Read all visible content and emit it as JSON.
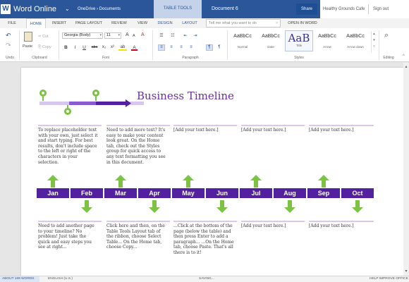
{
  "titlebar": {
    "logo_letter": "W",
    "app_name": "Word Online",
    "caret": "⌄",
    "breadcrumb": "OneDrive › Documents",
    "tool_band": "TABLE TOOLS",
    "document_name": "Document 6",
    "share": "Share",
    "user": "Healthy Grounds Cafe",
    "signout": "Sign out"
  },
  "tabs": [
    {
      "label": "FILE"
    },
    {
      "label": "HOME"
    },
    {
      "label": "INSERT"
    },
    {
      "label": "PAGE LAYOUT"
    },
    {
      "label": "REVIEW"
    },
    {
      "label": "VIEW"
    },
    {
      "label": "DESIGN"
    },
    {
      "label": "LAYOUT"
    },
    {
      "label": "OPEN IN WORD"
    }
  ],
  "tellme_placeholder": "Tell me what you want to do",
  "ribbon": {
    "undo_icon": "↶",
    "redo_icon": "↷",
    "paste_label": "Paste",
    "cut_label": "Cut",
    "copy_label": "Copy",
    "font_name": "Georgia (Body)",
    "font_size": "11",
    "grow_font": "A",
    "shrink_font": "A",
    "clear_format": "A",
    "bold": "B",
    "italic": "I",
    "underline": "U",
    "strike": "abc",
    "subscript": "x₂",
    "superscript": "x²",
    "highlight": "ab",
    "font_color": "A",
    "bullets_icon": "☰",
    "numbering_icon": "☷",
    "decrease_indent": "⇤",
    "increase_indent": "⇥",
    "align_left": "≡",
    "align_center": "≡",
    "align_right": "≡",
    "justify": "≡",
    "ltr": "¶",
    "rtl": "¶",
    "groups": {
      "undo": "Undo",
      "clipboard": "Clipboard",
      "font": "Font",
      "paragraph": "Paragraph",
      "styles": "Styles",
      "editing": "Editing"
    },
    "styles": [
      {
        "sample": "AaBbCc",
        "name": "Normal"
      },
      {
        "sample": "AaBbCc",
        "name": "Date"
      },
      {
        "sample": "AaB",
        "name": "Title"
      },
      {
        "sample": "AaBbCc",
        "name": "Arrow"
      },
      {
        "sample": "AaBbCc",
        "name": "Arrow down"
      }
    ],
    "find_icon": "⌕"
  },
  "document": {
    "heading": "Business Timeline",
    "top_texts": [
      "To replace placeholder text with your own, just select it and start typing. For best results, don't include space to the left or right of the characters in your selection.",
      "Need to add more text? It's easy to make your content look great. On the Home tab, check out the Styles group for quick access to any text formatting you see in this document.",
      "[Add your text here.]",
      "[Add your text here.]",
      "[Add your text here.]"
    ],
    "months": [
      "Jan",
      "Feb",
      "Mar",
      "Apr",
      "May",
      "Jun",
      "Jul",
      "Aug",
      "Sep",
      "Oct"
    ],
    "bottom_texts": [
      "Need to add another page to your timeline? No problem! Just take the quick and easy steps you see at right...",
      "Click here and then, on the Table Tools Layout tab of the ribbon, choose Select Table... On the Home tab, choose Copy...",
      "...Click at the bottom of the page (below the table) and then press Enter to add a paragraph... ...On the Home tab, choose Paste. That's all there is to it!",
      "[Add your text here.]",
      "[Add your text here.]"
    ]
  },
  "statusbar": {
    "word_count": "ABOUT 169 WORDS",
    "language": "ENGLISH (U.S.)",
    "saving": "SAVING...",
    "help": "HELP IMPROVE OFFICE"
  },
  "colors": {
    "word_blue": "#2b579a",
    "purple": "#5320a0",
    "heading_purple": "#6a2fa1",
    "green": "#7cc243"
  }
}
